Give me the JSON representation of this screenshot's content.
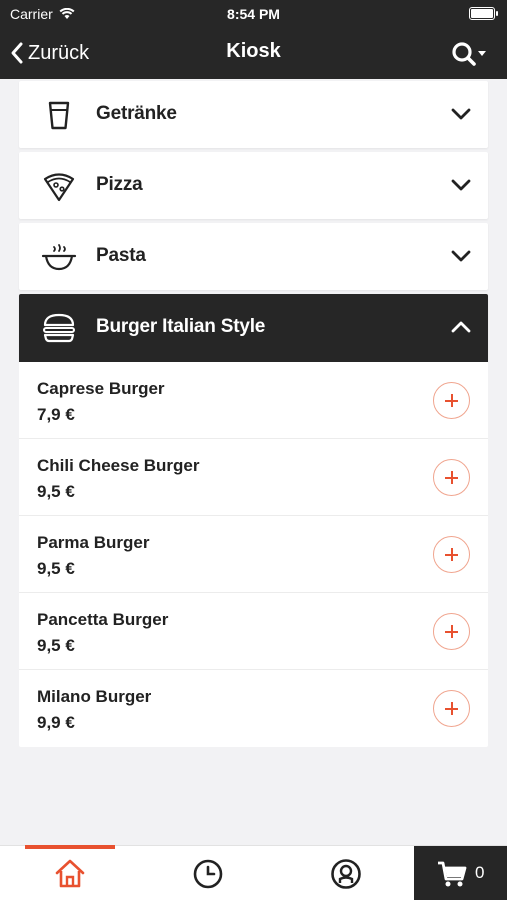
{
  "status_bar": {
    "carrier": "Carrier",
    "time": "8:54 PM"
  },
  "header": {
    "back_label": "Zurück",
    "title": "Kiosk"
  },
  "categories": [
    {
      "label": "Getränke",
      "icon": "cup-icon",
      "expanded": false
    },
    {
      "label": "Pizza",
      "icon": "pizza-slice-icon",
      "expanded": false
    },
    {
      "label": "Pasta",
      "icon": "pasta-bowl-icon",
      "expanded": false
    },
    {
      "label": "Burger Italian Style",
      "icon": "burger-icon",
      "expanded": true
    }
  ],
  "items": [
    {
      "name": "Caprese Burger",
      "price": "7,9 €"
    },
    {
      "name": "Chili Cheese Burger",
      "price": "9,5 €"
    },
    {
      "name": "Parma Burger",
      "price": "9,5 €"
    },
    {
      "name": "Pancetta Burger",
      "price": "9,5 €"
    },
    {
      "name": "Milano Burger",
      "price": "9,9 €"
    }
  ],
  "tab_bar": {
    "tabs": [
      {
        "icon": "home-icon",
        "active": true
      },
      {
        "icon": "clock-icon",
        "active": false
      },
      {
        "icon": "user-icon",
        "active": false
      }
    ],
    "cart_count": "0"
  },
  "colors": {
    "header_bg": "#272727",
    "accent": "#e8512f",
    "page_bg": "#f2f2f4"
  }
}
